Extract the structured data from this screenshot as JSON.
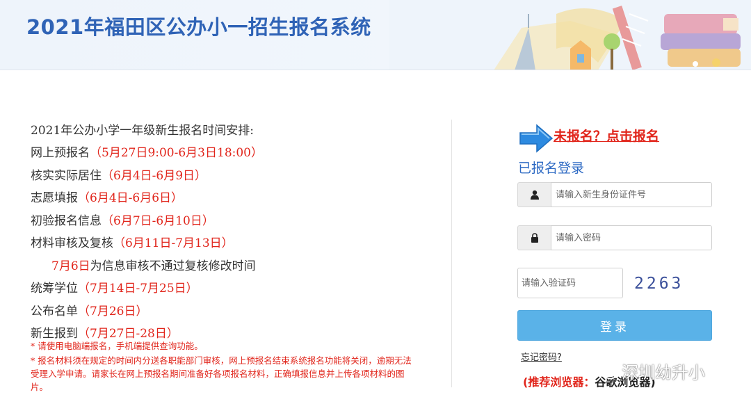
{
  "header": {
    "title": "2021年福田区公办小一招生报名系统"
  },
  "schedule": {
    "heading": "2021年公办小学一年级新生报名时间安排:",
    "items": [
      {
        "label": "网上预报名",
        "time": "（5月27日9:00-6月3日18:00）"
      },
      {
        "label": "核实实际居住",
        "time": "（6月4日-6月9日）"
      },
      {
        "label": "志愿填报",
        "time": "（6月4日-6月6日）"
      },
      {
        "label": "初验报名信息",
        "time": "（6月7日-6月10日）"
      },
      {
        "label": "材料审核及复核",
        "time": "（6月11日-7月13日）"
      }
    ],
    "note_line": {
      "red": "7月6日",
      "dark": "为信息审核不通过复核修改时间"
    },
    "items2": [
      {
        "label": "统筹学位",
        "time": "（7月14日-7月25日）"
      },
      {
        "label": "公布名单",
        "time": "（7月26日）"
      },
      {
        "label": "新生报到",
        "time": "（7月27日-28日）"
      }
    ]
  },
  "notes": [
    "* 请使用电脑端报名，手机端提供查询功能。",
    "* 报名材料须在规定的时间内分送各职能部门审核，网上预报名结束系统报名功能将关闭，逾期无法受理入学申请。请家长在网上预报名期间准备好各项报名材料，正确填报信息并上传各项材料的图片。"
  ],
  "login": {
    "register_link": "未报名？点击报名",
    "title": "已报名登录",
    "id_placeholder": "请输入新生身份证件号",
    "password_placeholder": "请输入密码",
    "captcha_placeholder": "请输入验证码",
    "captcha_code": "2263",
    "submit_label": "登录",
    "forgot_label": "忘记密码?",
    "browser_hint_prefix": "(推荐浏览器：",
    "browser_hint_name": "谷歌浏览器)"
  },
  "watermark": {
    "text": "深圳幼升小"
  },
  "icons": {
    "user": "user-icon",
    "lock": "lock-icon",
    "arrow": "arrow-right-icon",
    "wechat": "wechat-icon"
  },
  "colors": {
    "title_blue": "#2f63b6",
    "accent_red": "#e1251b",
    "button_blue": "#5ab2e8",
    "login_title_blue": "#2f6bc4"
  }
}
